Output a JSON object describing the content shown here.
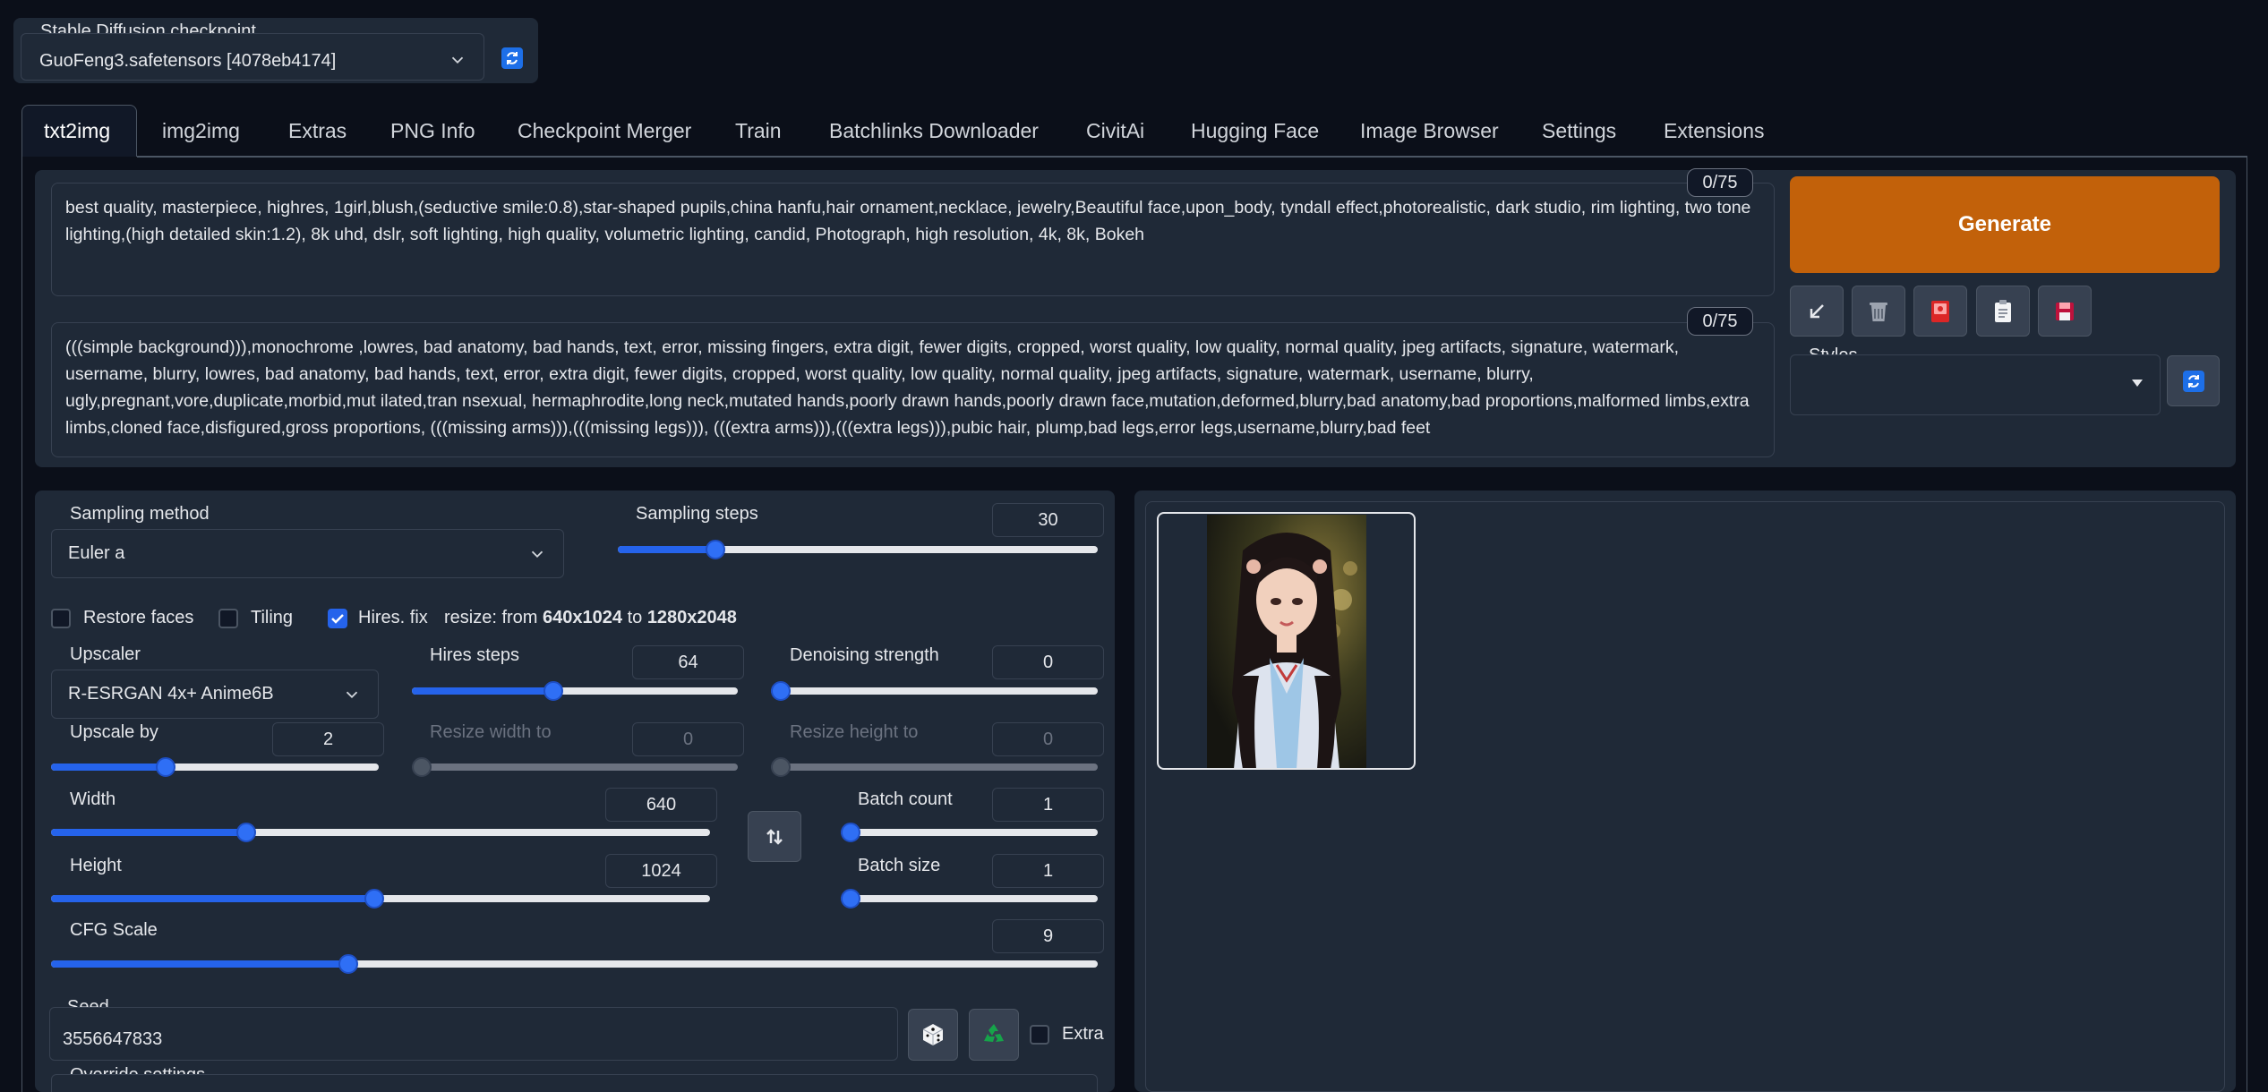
{
  "checkpoint": {
    "label": "Stable Diffusion checkpoint",
    "value": "GuoFeng3.safetensors [4078eb4174]"
  },
  "tabs": [
    "txt2img",
    "img2img",
    "Extras",
    "PNG Info",
    "Checkpoint Merger",
    "Train",
    "Batchlinks Downloader",
    "CivitAi",
    "Hugging Face",
    "Image Browser",
    "Settings",
    "Extensions"
  ],
  "active_tab": "txt2img",
  "prompt": {
    "text": "best quality, masterpiece, highres, 1girl,blush,(seductive smile:0.8),star-shaped pupils,china hanfu,hair ornament,necklace, jewelry,Beautiful face,upon_body, tyndall effect,photorealistic, dark studio, rim lighting, two tone lighting,(high detailed skin:1.2), 8k uhd, dslr, soft lighting, high quality, volumetric lighting, candid, Photograph, high resolution, 4k, 8k, Bokeh",
    "counter": "0/75"
  },
  "negative_prompt": {
    "text": "(((simple background))),monochrome ,lowres, bad anatomy, bad hands, text, error, missing fingers, extra digit, fewer digits, cropped, worst quality, low quality, normal quality, jpeg artifacts, signature, watermark, username, blurry, lowres, bad anatomy, bad hands, text, error, extra digit, fewer digits, cropped, worst quality, low quality, normal quality, jpeg artifacts, signature, watermark, username, blurry, ugly,pregnant,vore,duplicate,morbid,mut ilated,tran nsexual, hermaphrodite,long neck,mutated hands,poorly drawn hands,poorly drawn face,mutation,deformed,blurry,bad anatomy,bad proportions,malformed limbs,extra limbs,cloned face,disfigured,gross proportions, (((missing arms))),(((missing legs))), (((extra arms))),(((extra legs))),pubic hair, plump,bad legs,error legs,username,blurry,bad feet",
    "counter": "0/75"
  },
  "generate_label": "Generate",
  "styles_label": "Styles",
  "sampling": {
    "method_label": "Sampling method",
    "method_value": "Euler a",
    "steps_label": "Sampling steps",
    "steps_value": "30",
    "steps_fraction": 0.19
  },
  "options": {
    "restore_faces": "Restore faces",
    "tiling": "Tiling",
    "hires_fix": "Hires. fix",
    "resize_prefix": "resize: from ",
    "resize_from": "640x1024",
    "resize_mid": " to ",
    "resize_to": "1280x2048"
  },
  "hires": {
    "upscaler_label": "Upscaler",
    "upscaler_value": "R-ESRGAN 4x+ Anime6B",
    "steps_label": "Hires steps",
    "steps_value": "64",
    "steps_fraction": 0.43,
    "denoise_label": "Denoising strength",
    "denoise_value": "0",
    "denoise_fraction": 0.0,
    "upscale_label": "Upscale by",
    "upscale_value": "2",
    "upscale_fraction": 0.34,
    "resize_w_label": "Resize width to",
    "resize_w_value": "0",
    "resize_h_label": "Resize height to",
    "resize_h_value": "0"
  },
  "dims": {
    "width_label": "Width",
    "width_value": "640",
    "width_fraction": 0.29,
    "height_label": "Height",
    "height_value": "1024",
    "height_fraction": 0.49,
    "batch_count_label": "Batch count",
    "batch_count_value": "1",
    "batch_count_fraction": 0.0,
    "batch_size_label": "Batch size",
    "batch_size_value": "1",
    "batch_size_fraction": 0.0
  },
  "cfg": {
    "label": "CFG Scale",
    "value": "9",
    "fraction": 0.28
  },
  "seed": {
    "label": "Seed",
    "value": "3556647833",
    "extra_label": "Extra"
  },
  "override_label": "Override settings",
  "colors": {
    "accent": "#2563eb",
    "generate": "#c2610a",
    "background": "#0b0f19",
    "panel": "#1f2937"
  }
}
